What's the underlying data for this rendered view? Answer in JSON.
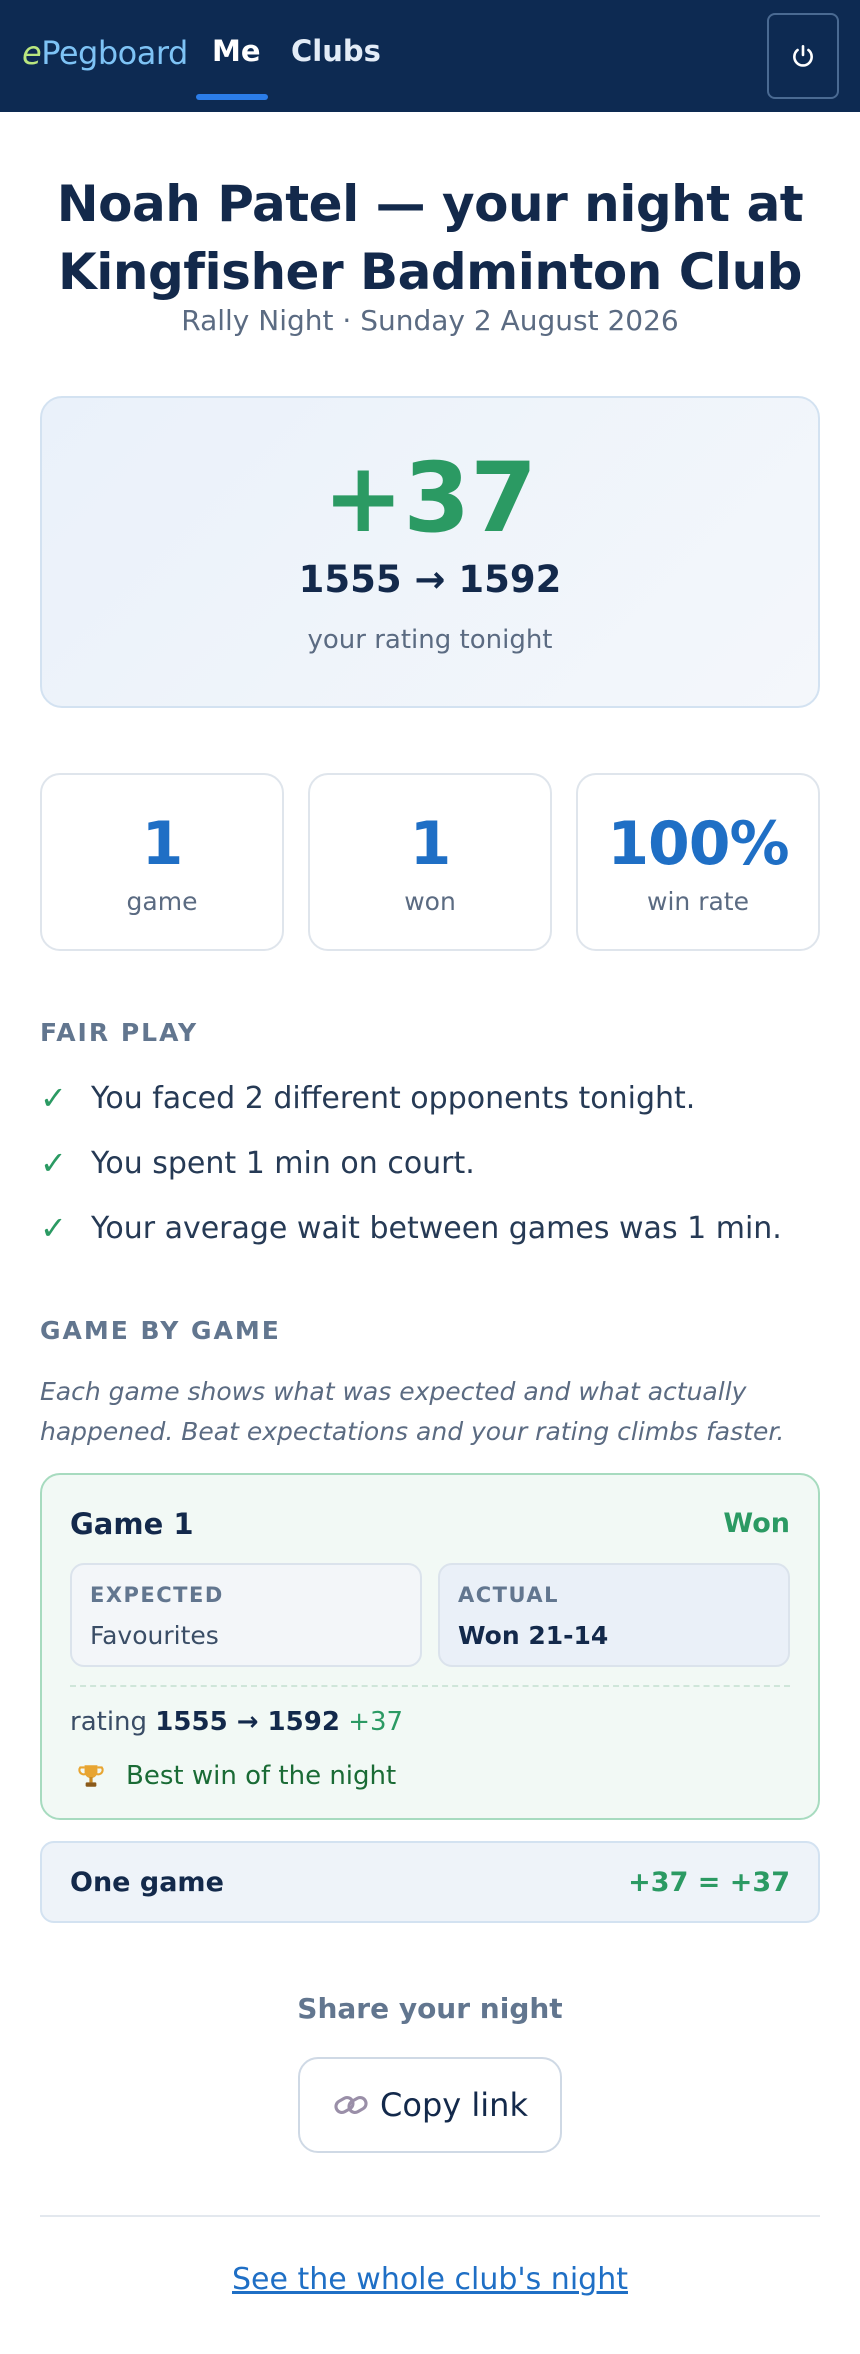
{
  "header": {
    "brand_e": "e",
    "brand_rest": "Pegboard",
    "nav": [
      {
        "label": "Me",
        "active": true
      },
      {
        "label": "Clubs",
        "active": false
      }
    ],
    "power_icon": "power-icon"
  },
  "page": {
    "title": "Noah Patel — your night at Kingfisher Badminton Club",
    "subtitle": "Rally Night · Sunday 2 August 2026"
  },
  "hero": {
    "delta": "+37",
    "range": "1555 → 1592",
    "caption": "your rating tonight"
  },
  "stats": [
    {
      "value": "1",
      "label": "game"
    },
    {
      "value": "1",
      "label": "won"
    },
    {
      "value": "100%",
      "label": "win rate"
    }
  ],
  "fair_play": {
    "heading": "FAIR PLAY",
    "check": "✓",
    "items": [
      "You faced 2 different opponents tonight.",
      "You spent 1 min on court.",
      "Your average wait between games was 1 min."
    ]
  },
  "games": {
    "heading": "GAME BY GAME",
    "intro": "Each game shows what was expected and what actually happened. Beat expectations and your rating climbs faster.",
    "list": [
      {
        "title": "Game 1",
        "result": "Won",
        "expected_label": "EXPECTED",
        "expected_value": "Favourites",
        "actual_label": "ACTUAL",
        "actual_value": "Won 21-14",
        "rating_prefix": "rating",
        "rating_range": "1555 → 1592",
        "rating_delta": "+37",
        "badge": "Best win of the night",
        "badge_icon": "trophy-icon"
      }
    ],
    "total_label": "One game",
    "total_sum": "+37 = +37"
  },
  "share": {
    "heading": "Share your night",
    "copy_label": "Copy link",
    "copy_icon": "link-icon"
  },
  "footer": {
    "club_link": "See the whole club's night"
  },
  "colors": {
    "nav_bg": "#0d2a52",
    "positive": "#2b9a63",
    "accent_blue": "#1f6fc5"
  }
}
